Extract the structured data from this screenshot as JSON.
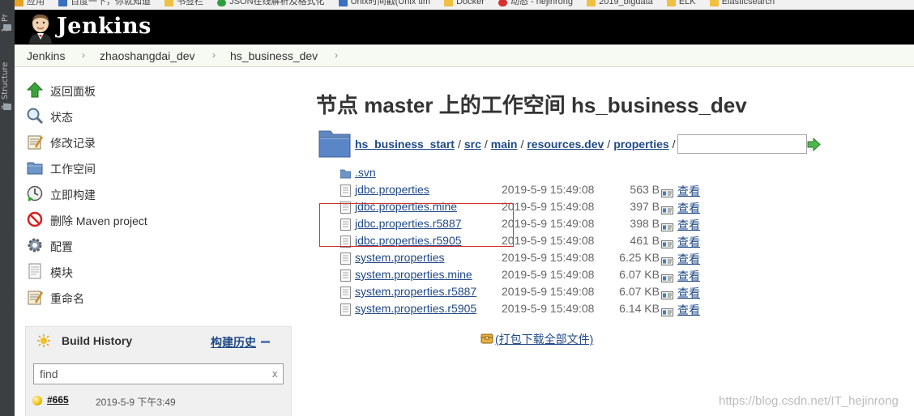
{
  "bookmarks": [
    "应用",
    "百度一下，你就知道",
    "书签栏",
    "JSON在线解析及格式化",
    "Unix时间戳(Unix tim",
    "Docker",
    "动态 - hejinrong",
    "2019_bigdata",
    "ELK",
    "Elasticsearch"
  ],
  "ide": {
    "strip_label_1": "1: Pr",
    "strip_label_2": "7: Structure"
  },
  "header": {
    "logo_text": "Jenkins"
  },
  "breadcrumb": [
    "Jenkins",
    "zhaoshangdai_dev",
    "hs_business_dev"
  ],
  "sidebar": {
    "tasks": [
      {
        "label": "返回面板",
        "icon": "up-arrow-icon"
      },
      {
        "label": "状态",
        "icon": "search-icon"
      },
      {
        "label": "修改记录",
        "icon": "notepad-icon"
      },
      {
        "label": "工作空间",
        "icon": "folder-icon"
      },
      {
        "label": "立即构建",
        "icon": "clock-icon"
      },
      {
        "label": "删除 Maven project",
        "icon": "no-entry-icon"
      },
      {
        "label": "配置",
        "icon": "gear-icon"
      },
      {
        "label": "模块",
        "icon": "document-icon"
      },
      {
        "label": "重命名",
        "icon": "notepad-icon"
      }
    ]
  },
  "build_history": {
    "title": "Build History",
    "trend_link": "构建历史",
    "filter_value": "find",
    "clear": "x",
    "builds": [
      {
        "number": "#665",
        "date": "2019-5-9 下午3:49"
      }
    ]
  },
  "main": {
    "title": "节点 master 上的工作空间 hs_business_dev",
    "path": [
      "hs_business_start",
      "src",
      "main",
      "resources.dev",
      "properties"
    ],
    "path_separator": "/",
    "files": [
      {
        "name": ".svn",
        "type": "folder",
        "date": "",
        "size": "",
        "view": ""
      },
      {
        "name": "jdbc.properties",
        "type": "file",
        "date": "2019-5-9 15:49:08",
        "size": "563 B",
        "view": "查看"
      },
      {
        "name": "jdbc.properties.mine",
        "type": "file",
        "date": "2019-5-9 15:49:08",
        "size": "397 B",
        "view": "查看"
      },
      {
        "name": "jdbc.properties.r5887",
        "type": "file",
        "date": "2019-5-9 15:49:08",
        "size": "398 B",
        "view": "查看"
      },
      {
        "name": "jdbc.properties.r5905",
        "type": "file",
        "date": "2019-5-9 15:49:08",
        "size": "461 B",
        "view": "查看"
      },
      {
        "name": "system.properties",
        "type": "file",
        "date": "2019-5-9 15:49:08",
        "size": "6.25 KB",
        "view": "查看"
      },
      {
        "name": "system.properties.mine",
        "type": "file",
        "date": "2019-5-9 15:49:08",
        "size": "6.07 KB",
        "view": "查看"
      },
      {
        "name": "system.properties.r5887",
        "type": "file",
        "date": "2019-5-9 15:49:08",
        "size": "6.07 KB",
        "view": "查看"
      },
      {
        "name": "system.properties.r5905",
        "type": "file",
        "date": "2019-5-9 15:49:08",
        "size": "6.14 KB",
        "view": "查看"
      }
    ],
    "zip_link": "(打包下载全部文件)"
  },
  "watermark": "https://blog.csdn.net/IT_hejinrong",
  "colors": {
    "link": "#204a87",
    "header_bg": "#000000",
    "breadcrumb_bg": "#f6faf2",
    "highlight_box": "#d03030"
  }
}
